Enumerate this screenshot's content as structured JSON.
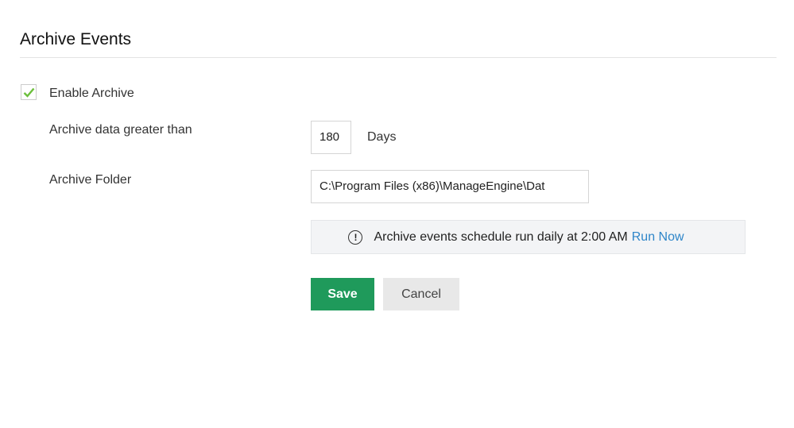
{
  "title": "Archive Events",
  "enable_archive": {
    "label": "Enable Archive",
    "checked": true
  },
  "archive_days": {
    "label": "Archive data greater than",
    "value": "180",
    "unit": "Days"
  },
  "archive_folder": {
    "label": "Archive Folder",
    "value": "C:\\Program Files (x86)\\ManageEngine\\Dat"
  },
  "notice": {
    "text": "Archive events schedule run daily at 2:00 AM",
    "link": "Run Now",
    "icon": "exclamation-circle-icon"
  },
  "buttons": {
    "save": "Save",
    "cancel": "Cancel"
  },
  "colors": {
    "accent": "#1f9a5b",
    "link": "#2f86c9",
    "check": "#6cbf3c"
  }
}
